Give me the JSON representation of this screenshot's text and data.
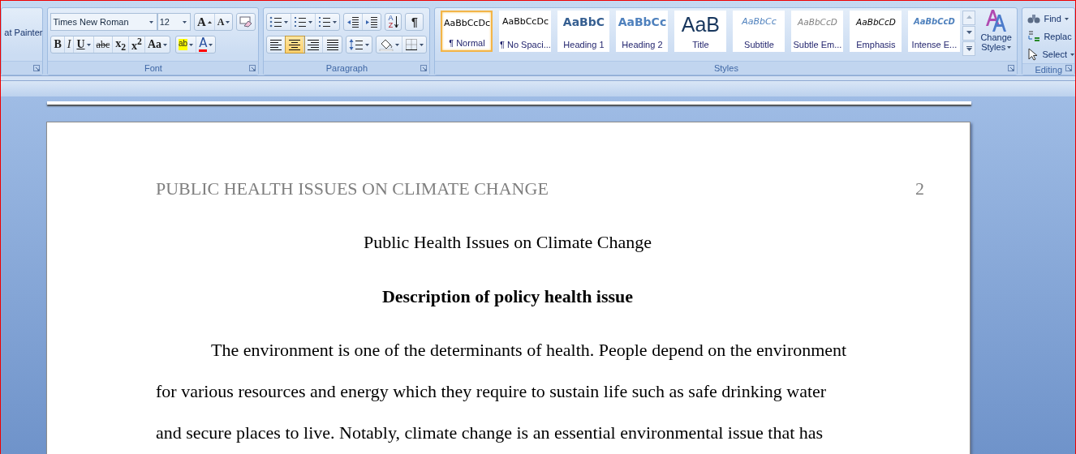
{
  "clipboard": {
    "format_painter": "at Painter"
  },
  "font": {
    "label": "Font",
    "font_name": "Times New Roman",
    "font_size": "12",
    "grow": "A",
    "shrink": "A",
    "buttons": [
      {
        "kind": "bold",
        "label": "B"
      },
      {
        "kind": "italic",
        "label": "I"
      },
      {
        "kind": "underline",
        "label": "U"
      },
      {
        "kind": "strike",
        "label": "abc"
      },
      {
        "kind": "subscript",
        "label": "x$_{2}$"
      },
      {
        "kind": "superscript",
        "label": "x$^{2}$"
      },
      {
        "kind": "case",
        "label": "Aa"
      }
    ],
    "highlight": "ab",
    "font_color": "A"
  },
  "paragraph": {
    "label": "Paragraph",
    "sort": [
      "A",
      "Z"
    ],
    "show_marks": "¶",
    "alignment": [
      {
        "kind": "left",
        "selected": false
      },
      {
        "kind": "center",
        "selected": true
      },
      {
        "kind": "right",
        "selected": false
      },
      {
        "kind": "justify",
        "selected": false
      }
    ]
  },
  "styles": {
    "label": "Styles",
    "change_styles": [
      "Change",
      "Styles"
    ],
    "items": [
      {
        "kind": "normal",
        "sample": "AaBbCcDc",
        "label": "¶ Normal",
        "selected": true
      },
      {
        "kind": "normal",
        "sample": "AaBbCcDc",
        "label": "¶ No Spaci...",
        "selected": false
      },
      {
        "kind": "heading1",
        "sample": "AaBbC",
        "label": "Heading 1",
        "selected": false
      },
      {
        "kind": "heading2",
        "sample": "AaBbCc",
        "label": "Heading 2",
        "selected": false
      },
      {
        "kind": "title",
        "sample": "AaB",
        "label": "Title",
        "selected": false
      },
      {
        "kind": "subtitle",
        "sample": "AaBbCc",
        "label": "Subtitle",
        "selected": false
      },
      {
        "kind": "subtle",
        "sample": "AaBbCcD",
        "label": "Subtle Em...",
        "selected": false
      },
      {
        "kind": "emphasis",
        "sample": "AaBbCcD",
        "label": "Emphasis",
        "selected": false
      },
      {
        "kind": "intense",
        "sample": "AaBbCcD",
        "label": "Intense E...",
        "selected": false
      }
    ]
  },
  "editing": {
    "label": "Editing",
    "items": [
      {
        "kind": "find",
        "label": "Find"
      },
      {
        "kind": "replace",
        "label": "Replac"
      },
      {
        "kind": "select",
        "label": "Select"
      }
    ]
  },
  "document": {
    "header": "PUBLIC HEALTH ISSUES ON CLIMATE CHANGE",
    "page_number": "2",
    "title": "Public Health Issues on Climate Change",
    "heading": "Description of policy health issue",
    "paragraph_lines": [
      "The environment is one of the determinants of health. People depend on the environment",
      "for various resources and energy which they require to sustain life such as safe drinking water",
      "and secure places to live. Notably, climate change is an essential environmental issue that has"
    ]
  }
}
